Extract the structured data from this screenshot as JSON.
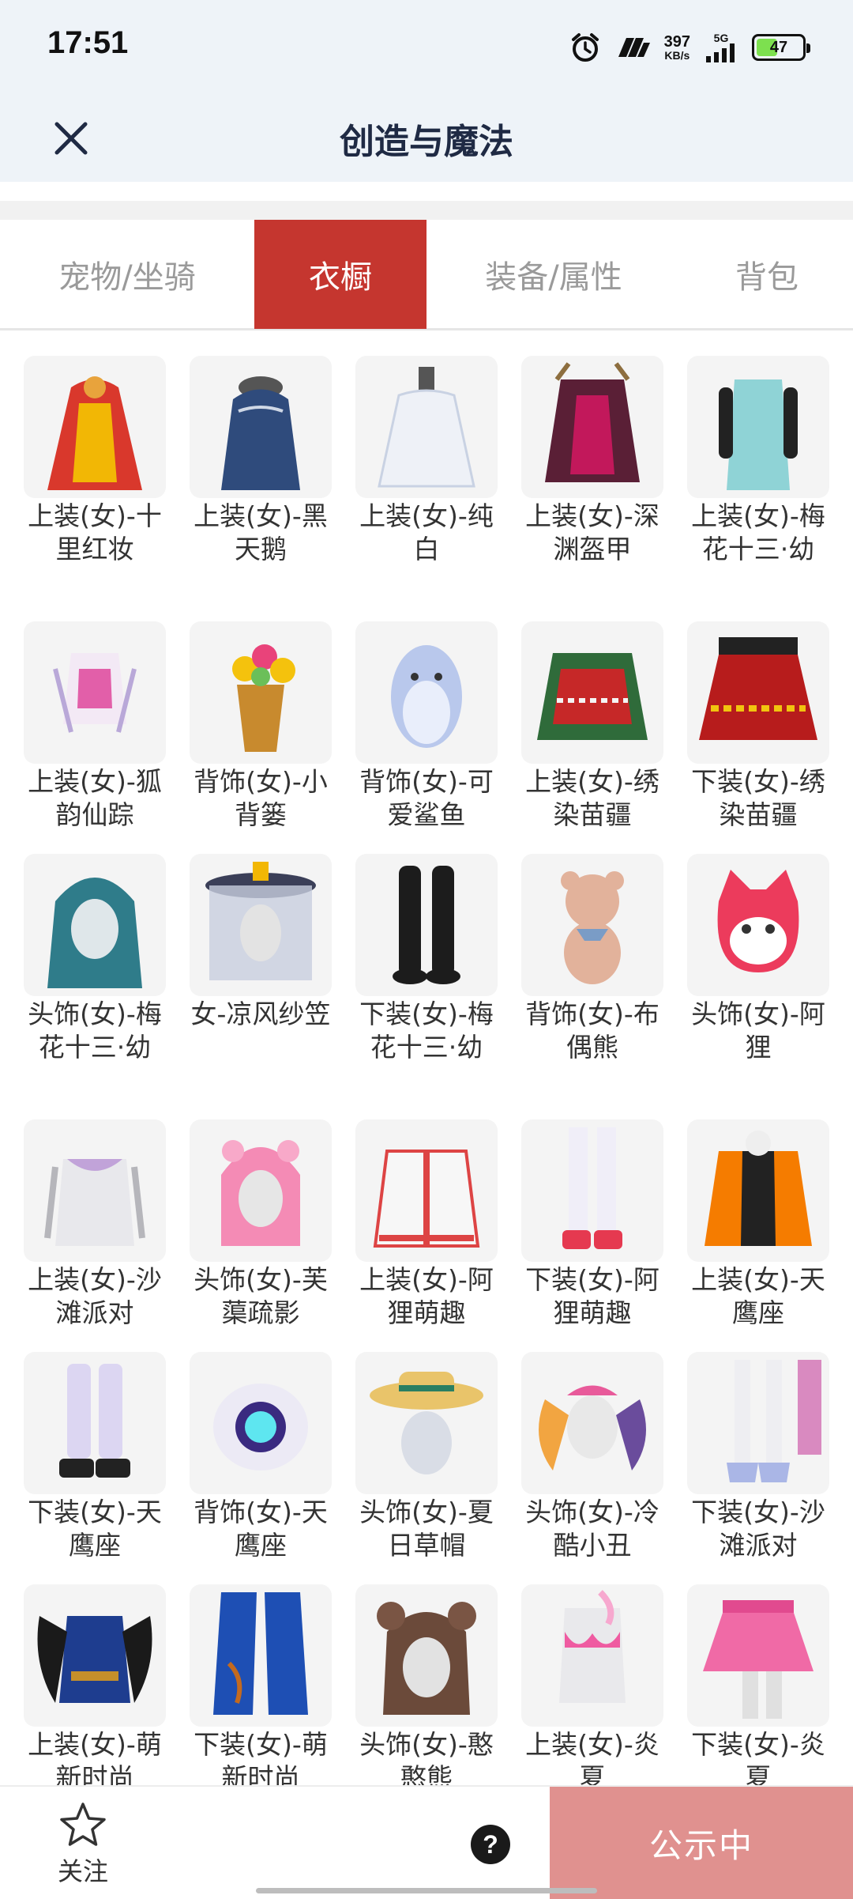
{
  "status_bar": {
    "time": "17:51",
    "net_speed": "397",
    "net_unit": "KB/s",
    "signal_label": "5G",
    "battery": "47",
    "battery_level": 0.47,
    "icons": [
      "alarm-icon",
      "network-logo-icon",
      "signal-icon",
      "battery-icon"
    ]
  },
  "header": {
    "title": "创造与魔法",
    "close_icon": "close-icon"
  },
  "tabs": [
    {
      "label": "宠物/坐骑",
      "active": false
    },
    {
      "label": "衣橱",
      "active": true
    },
    {
      "label": "装备/属性",
      "active": false
    },
    {
      "label": "背包",
      "active": false
    }
  ],
  "colors": {
    "accent": "#c5362f",
    "publish": "#e0918f",
    "header_bg": "#eef3f8",
    "thumb_bg": "#f4f4f4"
  },
  "items": [
    {
      "label": "上装(女)-十里红妆",
      "icon": "red-bridal-dress-icon"
    },
    {
      "label": "上装(女)-黑天鹅",
      "icon": "black-swan-gown-icon"
    },
    {
      "label": "上装(女)-纯白",
      "icon": "white-gown-icon"
    },
    {
      "label": "上装(女)-深渊盔甲",
      "icon": "abyss-armor-icon"
    },
    {
      "label": "上装(女)-梅花十三·幼",
      "icon": "teal-qipao-icon"
    },
    {
      "label": "上装(女)-狐韵仙踪",
      "icon": "fox-fairy-top-icon"
    },
    {
      "label": "背饰(女)-小背篓",
      "icon": "flower-basket-icon"
    },
    {
      "label": "背饰(女)-可爱鲨鱼",
      "icon": "shark-plush-icon"
    },
    {
      "label": "上装(女)-绣染苗疆",
      "icon": "miao-embroidered-top-icon"
    },
    {
      "label": "下装(女)-绣染苗疆",
      "icon": "miao-embroidered-skirt-icon"
    },
    {
      "label": "头饰(女)-梅花十三·幼",
      "icon": "teal-hair-icon"
    },
    {
      "label": "女-凉风纱笠",
      "icon": "veiled-hat-icon"
    },
    {
      "label": "下装(女)-梅花十三·幼",
      "icon": "black-boots-icon"
    },
    {
      "label": "背饰(女)-布偶熊",
      "icon": "teddy-bear-icon"
    },
    {
      "label": "头饰(女)-阿狸",
      "icon": "ali-fox-head-icon"
    },
    {
      "label": "上装(女)-沙滩派对",
      "icon": "beach-top-icon"
    },
    {
      "label": "头饰(女)-芙蕖疏影",
      "icon": "pink-hair-icon"
    },
    {
      "label": "上装(女)-阿狸萌趣",
      "icon": "white-jacket-icon"
    },
    {
      "label": "下装(女)-阿狸萌趣",
      "icon": "white-stockings-icon"
    },
    {
      "label": "上装(女)-天鹰座",
      "icon": "orange-jacket-icon"
    },
    {
      "label": "下装(女)-天鹰座",
      "icon": "mech-boots-icon"
    },
    {
      "label": "背饰(女)-天鹰座",
      "icon": "mech-backpack-icon"
    },
    {
      "label": "头饰(女)-夏日草帽",
      "icon": "straw-hat-icon"
    },
    {
      "label": "头饰(女)-冷酷小丑",
      "icon": "clown-pigtails-icon"
    },
    {
      "label": "下装(女)-沙滩派对",
      "icon": "beach-sandals-icon"
    },
    {
      "label": "上装(女)-萌新时尚",
      "icon": "blue-feather-top-icon"
    },
    {
      "label": "下装(女)-萌新时尚",
      "icon": "blue-pants-icon"
    },
    {
      "label": "头饰(女)-憨憨熊",
      "icon": "bear-ears-hair-icon"
    },
    {
      "label": "上装(女)-炎夏",
      "icon": "pink-bikini-top-icon"
    },
    {
      "label": "下装(女)-炎夏",
      "icon": "pink-skirt-icon"
    }
  ],
  "bottom_bar": {
    "follow_label": "关注",
    "help_label": "?",
    "publish_label": "公示中"
  }
}
